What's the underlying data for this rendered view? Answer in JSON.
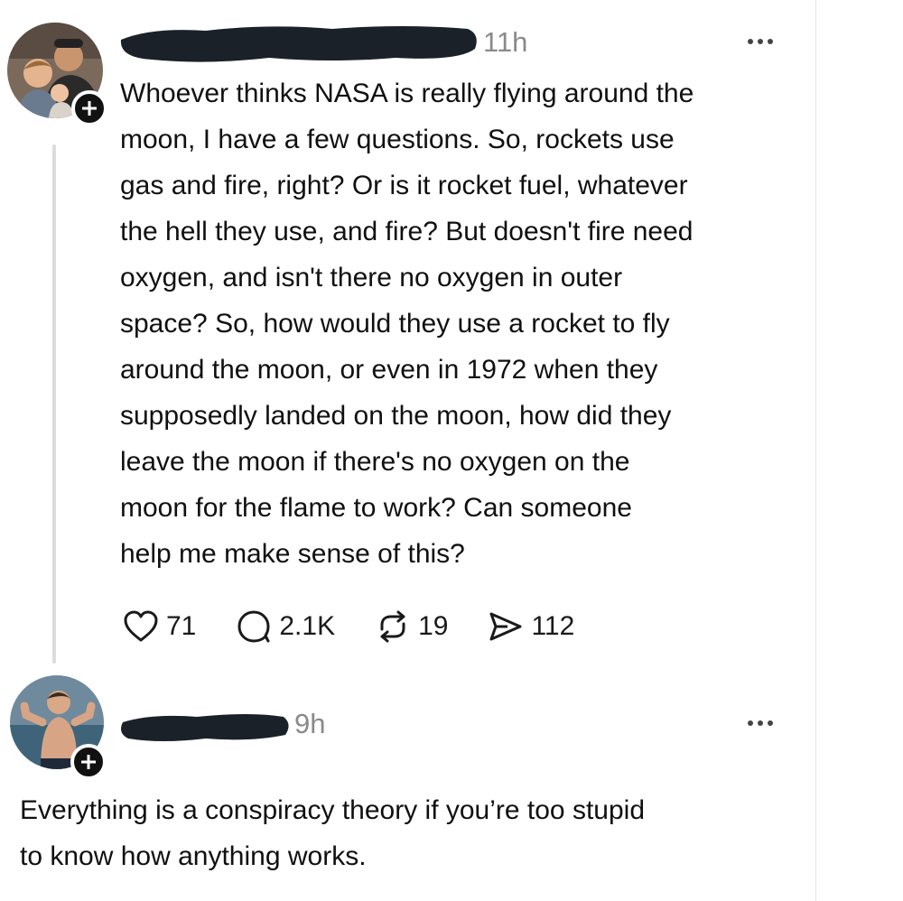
{
  "post": {
    "timestamp": "11h",
    "text": "Whoever thinks NASA is really flying around the\nmoon, I have a few questions. So, rockets use\ngas and fire, right? Or is it rocket fuel, whatever\nthe hell they use, and fire? But doesn't fire need\noxygen, and isn't there no oxygen in outer\nspace? So, how would they use a rocket to fly\naround the moon, or even in 1972 when they\nsupposedly landed on the moon, how did they\nleave the moon if there's no oxygen on the\nmoon for the flame to work? Can someone\nhelp me make sense of this?",
    "likes": "71",
    "replies": "2.1K",
    "reposts": "19",
    "shares": "112"
  },
  "reply": {
    "timestamp": "9h",
    "text": "Everything is a conspiracy theory if you’re too stupid\nto know how anything works."
  },
  "icons": {
    "like": "heart-icon",
    "reply": "comment-icon",
    "repost": "repost-icon",
    "share": "send-icon",
    "more": "more-options-icon",
    "follow": "plus-icon"
  },
  "colors": {
    "redaction": "#1b2129",
    "text": "#101010",
    "muted": "#8a8a8a"
  }
}
